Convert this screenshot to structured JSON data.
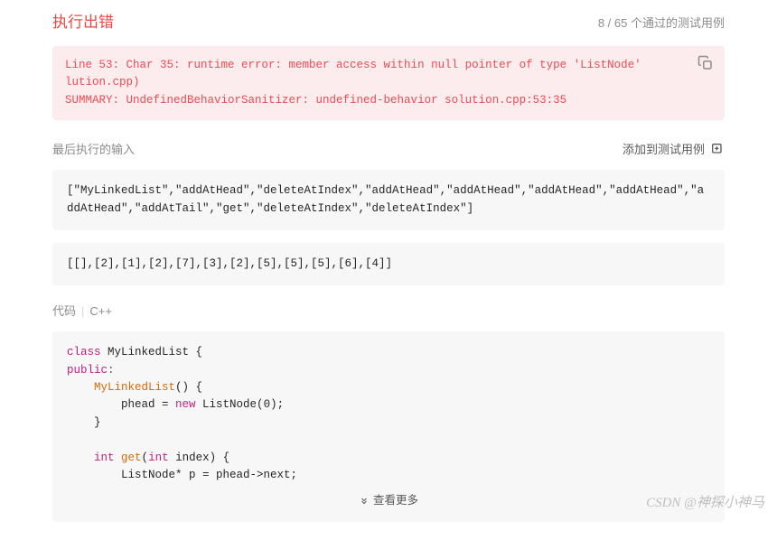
{
  "header": {
    "title": "执行出错",
    "passed": "8",
    "total": "65",
    "passed_suffix": " 个通过的测试用例"
  },
  "error": {
    "line1": "Line 53: Char 35: runtime error: member access within null pointer of type 'ListNode'",
    "line2": "lution.cpp)",
    "line3": "SUMMARY: UndefinedBehaviorSanitizer: undefined-behavior solution.cpp:53:35"
  },
  "last_input": {
    "label": "最后执行的输入",
    "add_label": "添加到测试用例",
    "input1": "[\"MyLinkedList\",\"addAtHead\",\"deleteAtIndex\",\"addAtHead\",\"addAtHead\",\"addAtHead\",\"addAtHead\",\"addAtHead\",\"addAtTail\",\"get\",\"deleteAtIndex\",\"deleteAtIndex\"]",
    "input2": "[[],[2],[1],[2],[7],[3],[2],[5],[5],[5],[6],[4]]"
  },
  "code": {
    "label_prefix": "代码",
    "language": "C++",
    "show_more": "查看更多",
    "lines": {
      "l1_kw": "class",
      "l1_cls": " MyLinkedList {",
      "l2": "public",
      "l2_colon": ":",
      "l3_fn": "MyLinkedList",
      "l3_paren": "() {",
      "l4_a": "        phead = ",
      "l4_kw": "new",
      "l4_b": " ListNode(",
      "l4_num": "0",
      "l4_c": ");",
      "l5": "    }",
      "l6": "",
      "l7_kw": "int",
      "l7_fn": " get",
      "l7_p": "(",
      "l7_kw2": "int",
      "l7_rest": " index) {",
      "l8": "        ListNode* p = phead->next;"
    }
  },
  "watermark": "CSDN @神探小神马"
}
